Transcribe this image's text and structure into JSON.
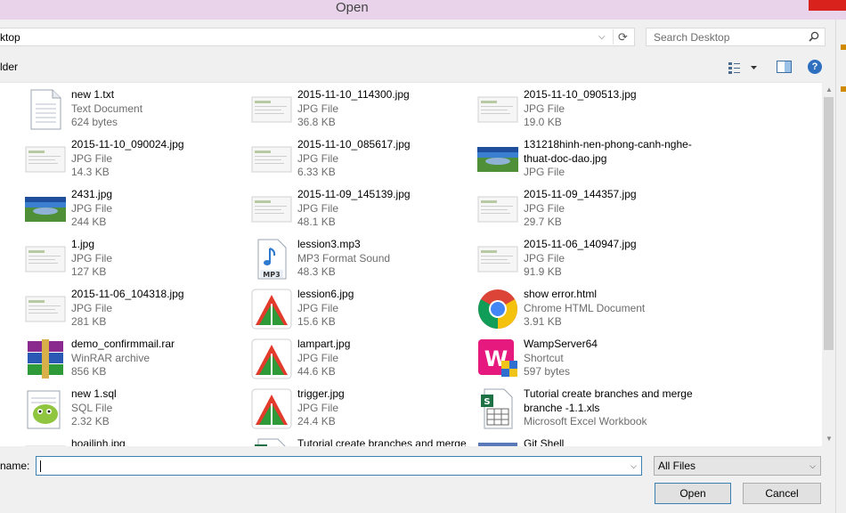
{
  "window": {
    "title": "Open"
  },
  "address": {
    "path": "ktop"
  },
  "search": {
    "placeholder": "Search Desktop"
  },
  "toolbar": {
    "new_folder_label": "lder"
  },
  "files": [
    {
      "name": "new 1.txt",
      "type": "Text Document",
      "size": "624 bytes",
      "icon": "text-file-icon"
    },
    {
      "name": "2015-11-10_114300.jpg",
      "type": "JPG File",
      "size": "36.8 KB",
      "icon": "image-thumbnail-icon"
    },
    {
      "name": "2015-11-10_090513.jpg",
      "type": "JPG File",
      "size": "19.0 KB",
      "icon": "image-thumbnail-icon"
    },
    {
      "name": "2015-11-10_090024.jpg",
      "type": "JPG File",
      "size": "14.3 KB",
      "icon": "image-thumbnail-icon"
    },
    {
      "name": "2015-11-10_085617.jpg",
      "type": "JPG File",
      "size": "6.33 KB",
      "icon": "image-thumbnail-icon"
    },
    {
      "name": "131218hinh-nen-phong-canh-nghe-thuat-doc-dao.jpg",
      "type": "JPG File",
      "size": "",
      "icon": "landscape-thumbnail-icon"
    },
    {
      "name": "2431.jpg",
      "type": "JPG File",
      "size": "244 KB",
      "icon": "landscape-thumbnail-icon"
    },
    {
      "name": "2015-11-09_145139.jpg",
      "type": "JPG File",
      "size": "48.1 KB",
      "icon": "image-thumbnail-icon"
    },
    {
      "name": "2015-11-09_144357.jpg",
      "type": "JPG File",
      "size": "29.7 KB",
      "icon": "image-thumbnail-icon"
    },
    {
      "name": "1.jpg",
      "type": "JPG File",
      "size": "127 KB",
      "icon": "image-thumbnail-icon"
    },
    {
      "name": "lession3.mp3",
      "type": "MP3 Format Sound",
      "size": "48.3 KB",
      "icon": "mp3-file-icon"
    },
    {
      "name": "2015-11-06_140947.jpg",
      "type": "JPG File",
      "size": "91.9 KB",
      "icon": "image-thumbnail-icon"
    },
    {
      "name": "2015-11-06_104318.jpg",
      "type": "JPG File",
      "size": "281 KB",
      "icon": "image-thumbnail-icon"
    },
    {
      "name": "lession6.jpg",
      "type": "JPG File",
      "size": "15.6 KB",
      "icon": "picture-viewer-icon"
    },
    {
      "name": "show error.html",
      "type": "Chrome HTML Document",
      "size": "3.91 KB",
      "icon": "chrome-icon"
    },
    {
      "name": "demo_confirmmail.rar",
      "type": "WinRAR archive",
      "size": "856 KB",
      "icon": "winrar-icon"
    },
    {
      "name": "lampart.jpg",
      "type": "JPG File",
      "size": "44.6 KB",
      "icon": "picture-viewer-icon"
    },
    {
      "name": "WampServer64",
      "type": "Shortcut",
      "size": "597 bytes",
      "icon": "wampserver-icon"
    },
    {
      "name": "new 1.sql",
      "type": "SQL File",
      "size": "2.32 KB",
      "icon": "notepad-plus-icon"
    },
    {
      "name": "trigger.jpg",
      "type": "JPG File",
      "size": "24.4 KB",
      "icon": "picture-viewer-icon"
    },
    {
      "name": "Tutorial create branches and merge branche -1.1.xls",
      "type": "Microsoft Excel Workbook",
      "size": "",
      "icon": "excel-file-icon"
    },
    {
      "name": "hoailinh.jpg",
      "type": "",
      "size": "",
      "icon": "image-thumbnail-icon"
    },
    {
      "name": "Tutorial create branches and merge",
      "type": "",
      "size": "",
      "icon": "excel-file-icon"
    },
    {
      "name": "Git Shell",
      "type": "",
      "size": "",
      "icon": "git-shell-icon"
    }
  ],
  "bottom": {
    "filename_label": "name:",
    "filename_value": "",
    "filter_value": "All Files",
    "open_label": "Open",
    "cancel_label": "Cancel"
  },
  "colors": {
    "selection_border": "#3c7fb1",
    "title_bg": "#e8d3eb"
  }
}
